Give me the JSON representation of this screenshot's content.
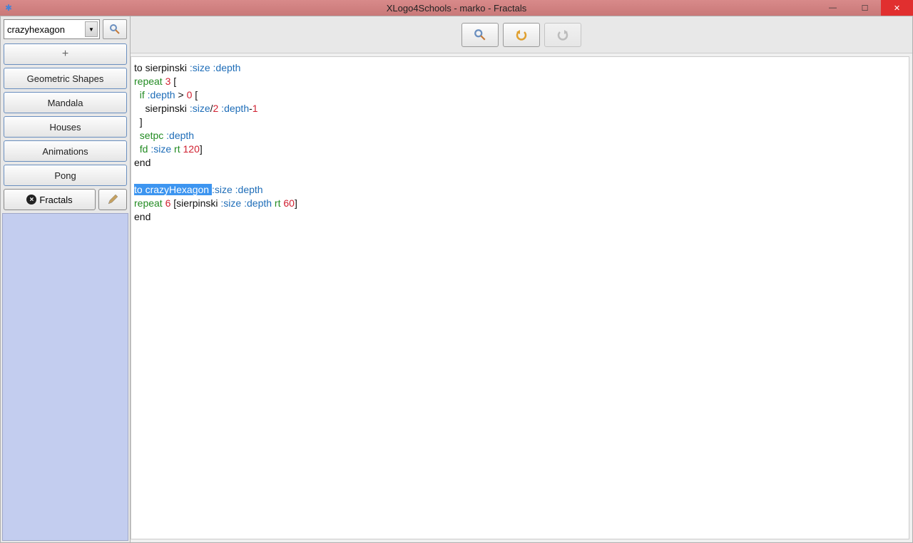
{
  "window": {
    "title": "XLogo4Schools - marko - Fractals"
  },
  "sidebar": {
    "selected_procedure": "crazyhexagon",
    "buttons": {
      "geometric_shapes": "Geometric Shapes",
      "mandala": "Mandala",
      "houses": "Houses",
      "animations": "Animations",
      "pong": "Pong",
      "fractals": "Fractals"
    }
  },
  "code": {
    "proc1": {
      "l1_to": "to",
      "l1_name": " sierpinski ",
      "l1_p1": ":size",
      "l1_p2": " :depth",
      "l2_repeat": "repeat ",
      "l2_num": "3",
      "l2_bracket": " [",
      "l3_if": "  if ",
      "l3_var": ":depth",
      "l3_gt": " > ",
      "l3_zero": "0",
      "l3_bracket": " [",
      "l4_indent": "    sierpinski ",
      "l4_size": ":size",
      "l4_div": "/",
      "l4_two": "2",
      "l4_depth": " :depth",
      "l4_minus": "-",
      "l4_one": "1",
      "l5": "  ]",
      "l6_setpc": "  setpc ",
      "l6_depth": ":depth",
      "l7_fd": "  fd ",
      "l7_size": ":size",
      "l7_rt": " rt ",
      "l7_num": "120",
      "l7_close": "]",
      "l8_end": "end"
    },
    "proc2": {
      "l1_to": "to",
      "l1_name": " crazyHexagon ",
      "l1_p1": ":size",
      "l1_p2": " :depth",
      "l2_repeat": "repeat ",
      "l2_num": "6",
      "l2_b1": " [",
      "l2_call": "sierpinski ",
      "l2_size": ":size",
      "l2_depth": " :depth",
      "l2_rt": " rt ",
      "l2_sixty": "60",
      "l2_close": "]",
      "l3_end": "end"
    }
  }
}
